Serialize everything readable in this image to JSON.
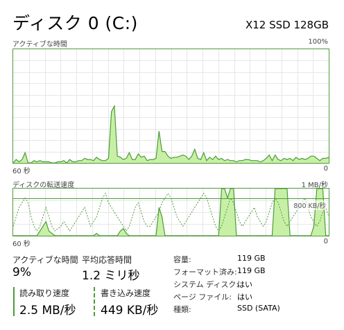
{
  "header": {
    "title": "ディスク 0 (C:)",
    "model": "X12 SSD 128GB"
  },
  "graph1": {
    "label": "アクティブな時間",
    "max_label": "100%",
    "time_label": "60 秒",
    "zero_label": "0",
    "colors": {
      "fill": "#c7f0a6",
      "line": "#4d9a3a",
      "grid": "#e6e6e6"
    },
    "series": [
      0,
      3,
      1,
      3,
      9,
      0,
      0,
      2,
      1,
      2,
      1,
      1,
      1,
      0,
      0,
      1,
      1,
      2,
      0,
      3,
      1,
      1,
      2,
      2,
      4,
      3,
      3,
      2,
      5,
      3,
      2,
      2,
      4,
      45,
      50,
      6,
      5,
      3,
      4,
      9,
      3,
      3,
      8,
      5,
      6,
      2,
      3,
      3,
      4,
      28,
      10,
      10,
      6,
      4,
      5,
      5,
      6,
      7,
      6,
      3,
      6,
      12,
      4,
      3,
      9,
      2,
      5,
      3,
      6,
      3,
      4,
      2,
      3,
      2,
      2,
      1,
      2,
      2,
      3,
      3,
      2,
      2,
      2,
      1,
      2,
      4,
      7,
      2,
      7,
      3,
      2,
      4,
      3,
      4,
      2,
      5,
      3,
      4,
      3,
      4,
      6,
      6,
      4,
      2,
      4,
      4,
      5
    ]
  },
  "graph2": {
    "label": "ディスクの転送速度",
    "max_label": "1 MB/秒",
    "ref_label": "800 KB/秒",
    "time_label": "60 秒",
    "zero_label": "0",
    "colors": {
      "fill": "#c7f0a6",
      "line": "#4d9a3a",
      "grid": "#e6e6e6"
    },
    "read_series": [
      0,
      0,
      0,
      0,
      0,
      0,
      0,
      0,
      0,
      10,
      20,
      30,
      10,
      5,
      0,
      0,
      0,
      0,
      0,
      0,
      0,
      0,
      0,
      0,
      0,
      0,
      0,
      0,
      5,
      0,
      0,
      0,
      0,
      0,
      0,
      0,
      10,
      15,
      5,
      0,
      0,
      0,
      0,
      0,
      0,
      0,
      0,
      0,
      0,
      60,
      40,
      0,
      0,
      0,
      0,
      0,
      0,
      0,
      0,
      0,
      0,
      0,
      0,
      0,
      0,
      0,
      0,
      0,
      0,
      0,
      100,
      100,
      80,
      100,
      100,
      0,
      0,
      0,
      0,
      0,
      0,
      0,
      0,
      0,
      0,
      0,
      0,
      0,
      100,
      100,
      100,
      100,
      100,
      0,
      0,
      0,
      0,
      0,
      0,
      0,
      0,
      20,
      100,
      100,
      100,
      0,
      0
    ],
    "write_series": [
      20,
      40,
      60,
      70,
      80,
      70,
      40,
      20,
      10,
      20,
      40,
      60,
      40,
      20,
      10,
      15,
      20,
      30,
      20,
      10,
      20,
      30,
      40,
      50,
      60,
      40,
      20,
      30,
      40,
      60,
      80,
      90,
      70,
      60,
      50,
      40,
      30,
      20,
      10,
      20,
      40,
      60,
      70,
      50,
      30,
      20,
      20,
      30,
      40,
      50,
      70,
      80,
      90,
      80,
      60,
      40,
      30,
      20,
      30,
      40,
      50,
      60,
      70,
      80,
      90,
      80,
      60,
      40,
      20,
      10,
      20,
      40,
      60,
      80,
      70,
      50,
      30,
      20,
      30,
      40,
      50,
      60,
      40,
      30,
      20,
      30,
      50,
      70,
      80,
      70,
      50,
      30,
      20,
      30,
      40,
      50,
      60,
      70,
      80,
      60,
      40,
      30,
      20,
      30,
      50,
      60,
      40
    ]
  },
  "stats": {
    "active_time_label": "アクティブな時間",
    "active_time_value": "9%",
    "response_label": "平均応答時間",
    "response_value": "1.2 ミリ秒",
    "read_label": "読み取り速度",
    "read_value": "2.5 MB/秒",
    "write_label": "書き込み速度",
    "write_value": "449 KB/秒"
  },
  "properties": {
    "capacity_label": "容量:",
    "capacity_value": "119 GB",
    "formatted_label": "フォーマット済み:",
    "formatted_value": "119 GB",
    "system_disk_label": "システム ディスク:",
    "system_disk_value": "はい",
    "page_file_label": "ページ ファイル:",
    "page_file_value": "はい",
    "type_label": "種類:",
    "type_value": "SSD (SATA)"
  }
}
